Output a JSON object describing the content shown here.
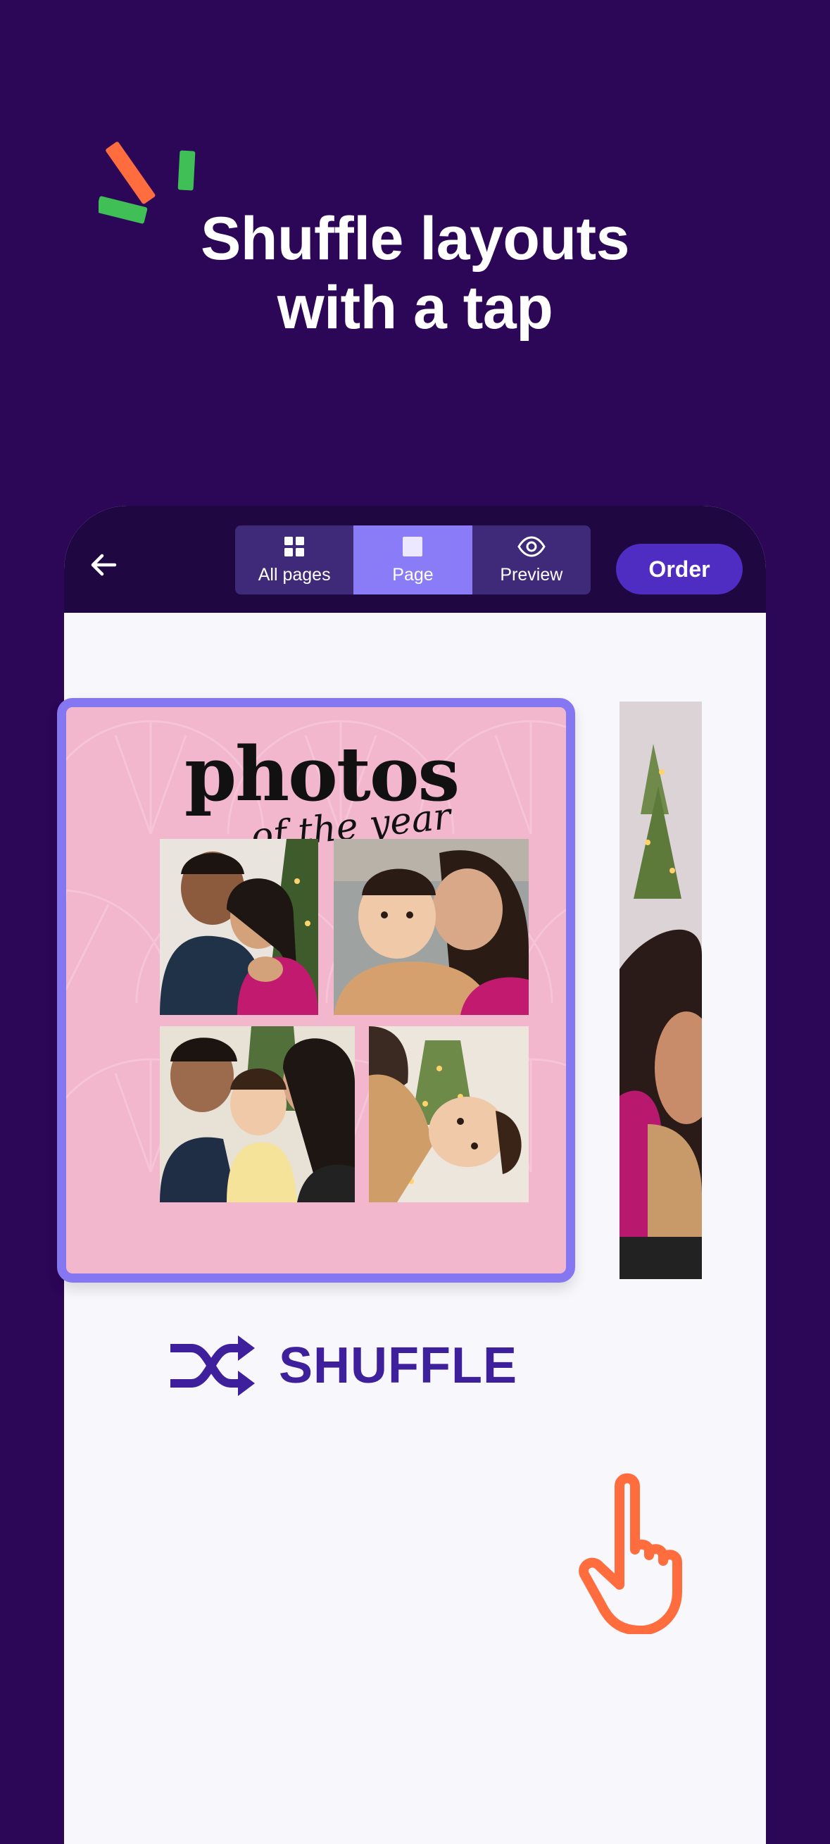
{
  "headline": {
    "line1": "Shuffle layouts",
    "line2": "with a tap"
  },
  "topbar": {
    "back_icon": "arrow-left-icon",
    "tabs": [
      {
        "label": "All pages",
        "icon": "grid-icon",
        "active": false
      },
      {
        "label": "Page",
        "icon": "square-icon",
        "active": true
      },
      {
        "label": "Preview",
        "icon": "eye-icon",
        "active": false
      }
    ],
    "order_label": "Order"
  },
  "page": {
    "title": "photos",
    "subtitle": "of the year",
    "photo_count": 4
  },
  "shuffle": {
    "label": "SHUFFLE",
    "icon": "shuffle-icon"
  },
  "colors": {
    "background": "#2c0657",
    "topbar": "#1f0742",
    "accent": "#8a7cf6",
    "order_button": "#4f2dc2",
    "page_bg": "#f2b6cd",
    "shuffle_text": "#3e1f9c",
    "hand": "#ff6d3f"
  }
}
